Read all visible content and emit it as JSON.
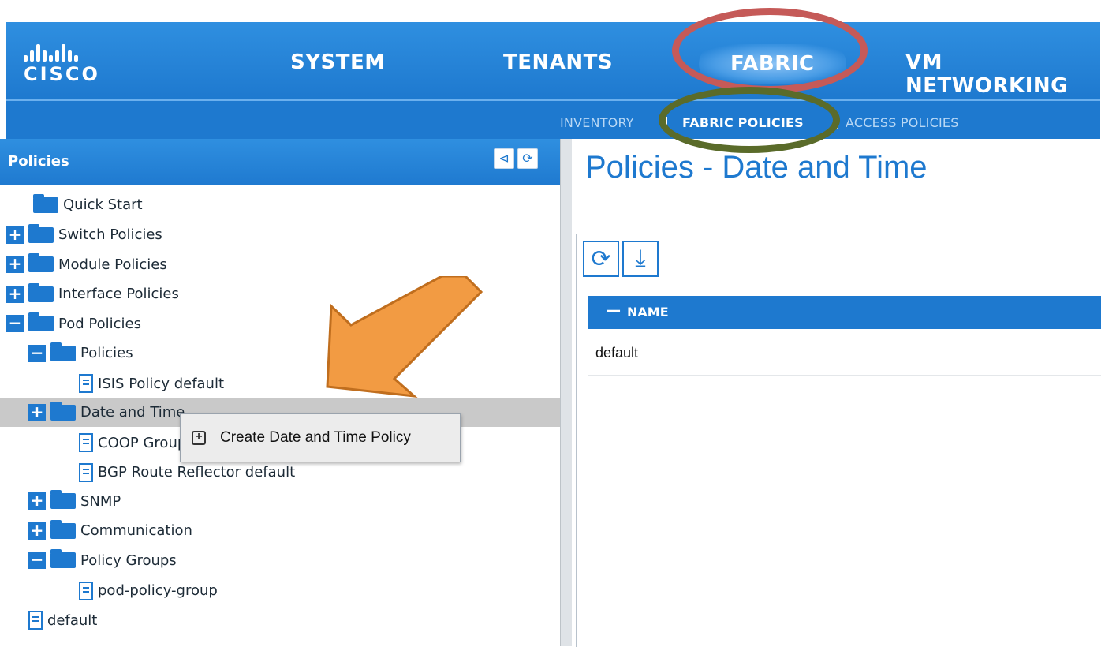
{
  "header": {
    "logo_text": "CISCO",
    "nav": [
      "SYSTEM",
      "TENANTS",
      "FABRIC",
      "VM NETWORKING"
    ],
    "active_nav": "FABRIC",
    "subnav": [
      "INVENTORY",
      "FABRIC POLICIES",
      "ACCESS POLICIES"
    ],
    "active_subnav": "FABRIC POLICIES"
  },
  "left_panel": {
    "title": "Policies",
    "icons": [
      "topology-icon",
      "refresh-icon"
    ],
    "tree": [
      {
        "label": "Quick Start",
        "icon": "folder",
        "expander": "none"
      },
      {
        "label": "Switch Policies",
        "icon": "folder",
        "expander": "plus"
      },
      {
        "label": "Module Policies",
        "icon": "folder",
        "expander": "plus"
      },
      {
        "label": "Interface Policies",
        "icon": "folder",
        "expander": "plus"
      },
      {
        "label": "Pod Policies",
        "icon": "folder",
        "expander": "minus"
      },
      {
        "label": "Policies",
        "icon": "folder",
        "expander": "minus"
      },
      {
        "label": "ISIS Policy default",
        "icon": "doc",
        "expander": "none"
      },
      {
        "label": "Date and Time",
        "icon": "folder",
        "expander": "plus",
        "selected": true
      },
      {
        "label": "COOP Group Policy default",
        "icon": "doc",
        "expander": "none"
      },
      {
        "label": "BGP Route Reflector default",
        "icon": "doc",
        "expander": "none"
      },
      {
        "label": "SNMP",
        "icon": "folder",
        "expander": "plus"
      },
      {
        "label": "Communication",
        "icon": "folder",
        "expander": "plus"
      },
      {
        "label": "Policy Groups",
        "icon": "folder",
        "expander": "minus"
      },
      {
        "label": "pod-policy-group",
        "icon": "doc",
        "expander": "none"
      },
      {
        "label": "default",
        "icon": "doc",
        "expander": "none"
      }
    ]
  },
  "context_menu": {
    "icon": "plus-square-icon",
    "label": "Create Date and Time Policy"
  },
  "main": {
    "title": "Policies - Date and Time",
    "toolbar_icons": [
      "refresh-icon",
      "download-icon"
    ],
    "table": {
      "sort_glyph": "—",
      "columns": [
        "NAME"
      ],
      "rows": [
        [
          "default"
        ]
      ]
    }
  },
  "colors": {
    "brand_blue": "#1e79cf",
    "highlight_red": "#c55a58",
    "highlight_green": "#5a6b2a",
    "arrow_orange": "#f29b43"
  }
}
